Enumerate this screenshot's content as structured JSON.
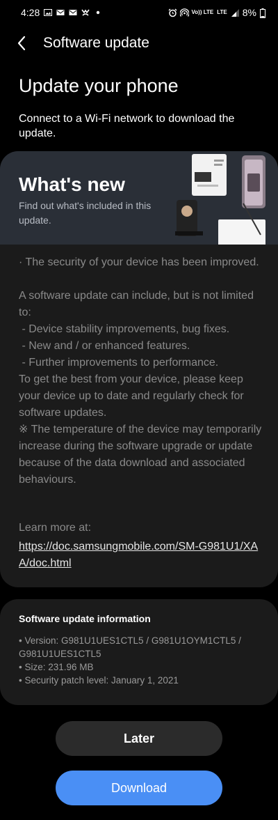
{
  "status_bar": {
    "time": "4:28",
    "battery": "8%",
    "left_icons": [
      "image-icon",
      "mail-icon",
      "mail-icon",
      "missed-call-icon",
      "dot-icon"
    ],
    "right_icons": [
      "alarm-icon",
      "hotspot-icon",
      "volte-icon",
      "signal-icon",
      "battery-icon"
    ],
    "volte_text": "Vo)) LTE",
    "lte_text": "LTE"
  },
  "app_bar": {
    "title": "Software update"
  },
  "main": {
    "headline": "Update your phone",
    "subline": "Connect to a Wi-Fi network to download the update."
  },
  "whats_new": {
    "title": "What's new",
    "subtitle": "Find out what's included in this update.",
    "notes": "· The security of your device has been improved.\n\nA software update can include, but is not limited to:\n - Device stability improvements, bug fixes.\n - New and / or enhanced features.\n - Further improvements to performance.\nTo get the best from your device, please keep your device up to date and regularly check for software updates.\n※ The temperature of the device may temporarily increase during the software upgrade or update because of the data download and associated behaviours.",
    "learn_more_label": "Learn more at:",
    "link": "https://doc.samsungmobile.com/SM-G981U1/XAA/doc.html"
  },
  "update_info": {
    "title": "Software update information",
    "items": [
      "• Version: G981U1UES1CTL5 / G981U1OYM1CTL5 / G981U1UES1CTL5",
      "• Size: 231.96 MB",
      "• Security patch level: January 1, 2021"
    ]
  },
  "buttons": {
    "later": "Later",
    "download": "Download"
  },
  "colors": {
    "background": "#000000",
    "card": "#1b1b1b",
    "hero": "#2a2f37",
    "accent": "#4a8ff5"
  }
}
